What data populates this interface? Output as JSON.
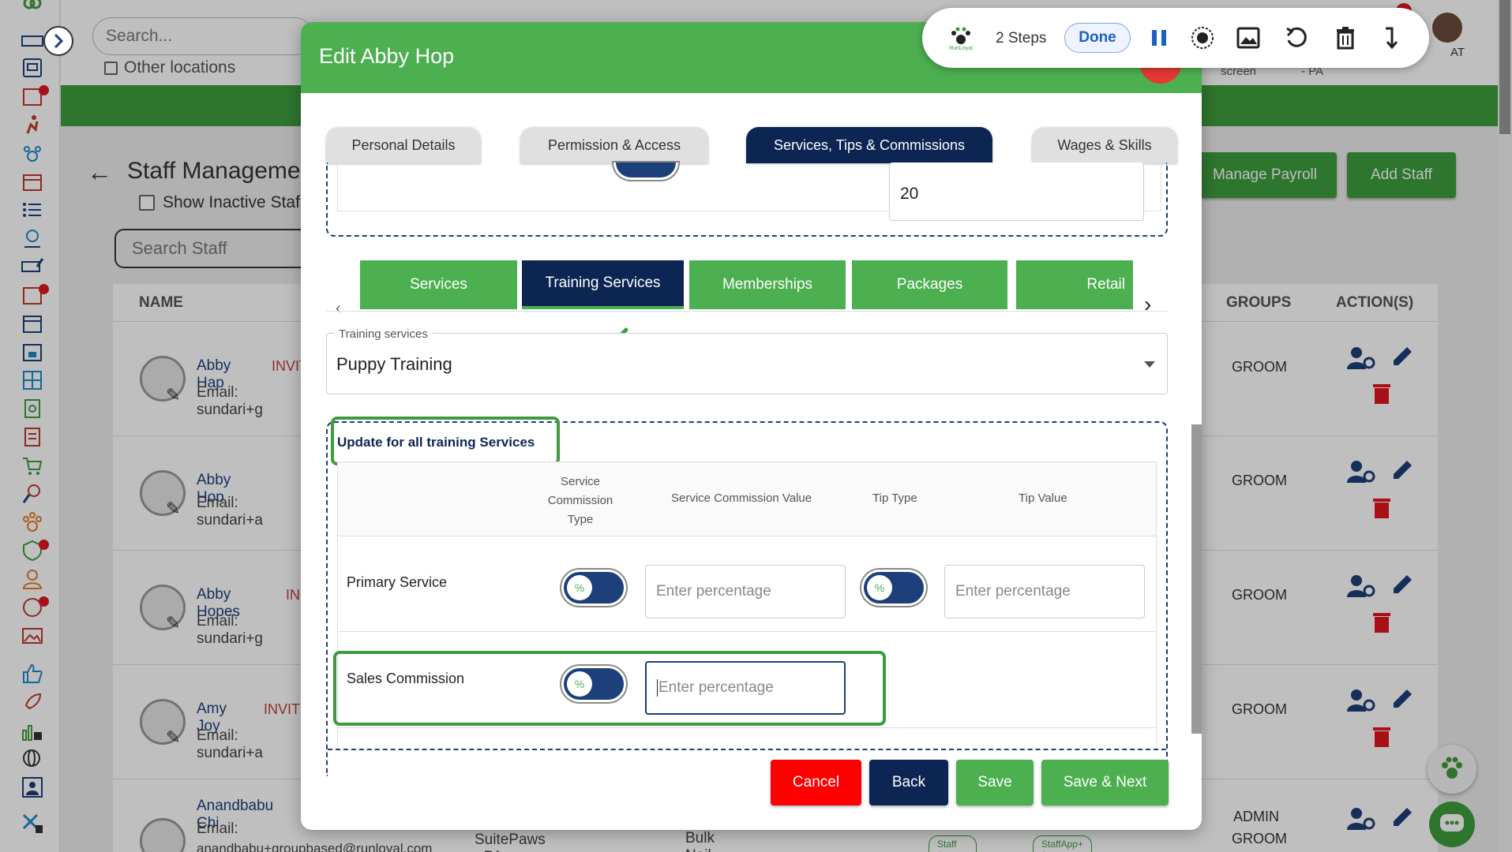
{
  "background": {
    "search_placeholder": "Search...",
    "other_locations": "Other locations",
    "page_title": "Staff Managemen",
    "show_inactive": "Show Inactive Staf",
    "search_staff": "Search Staff",
    "manage_payroll": "Manage Payroll",
    "add_staff": "Add Staff",
    "top_screen": "screen",
    "top_pa": "- PA",
    "top_at": "AT",
    "headers": {
      "name": "NAME",
      "groups": "GROUPS",
      "actions": "ACTION(S)"
    },
    "staff": [
      {
        "name": "Abby Hap",
        "status": "INVIT",
        "email": "Email: sundari+g",
        "group": "GROOM"
      },
      {
        "name": "Abby Hop",
        "status": "",
        "email": "Email: sundari+a",
        "group": "GROOM"
      },
      {
        "name": "Abby Hopes",
        "status": "IN",
        "email": "Email: sundari+g",
        "group": "GROOM"
      },
      {
        "name": "Amy Joy",
        "status": "INVIT",
        "email": "Email: sundari+a",
        "group": "GROOM"
      },
      {
        "name": "Anandbabu Chi",
        "status": "",
        "email": "Email:",
        "email2": "anandbabu+groupbased@runloyal.com",
        "group": "ADMIN",
        "group2": "GROOM"
      }
    ],
    "bottom_location": "SuitePaws - PA",
    "bottom_service": "Bulk Nail Trim",
    "badges": [
      "Staff App Access",
      "StaffApp+ for Kennel"
    ]
  },
  "modal": {
    "title": "Edit Abby Hop",
    "tabs": [
      "Personal Details",
      "Permission & Access",
      "Services, Tips & Commissions",
      "Wages & Skills"
    ],
    "top_value": "20",
    "service_tabs": [
      "Services",
      "Training Services",
      "Memberships",
      "Packages",
      "Retail"
    ],
    "training_label": "Training services",
    "training_value": "Puppy Training",
    "update_all": "Update for all training Services",
    "table_headers": {
      "sct1": "Service",
      "sct2": "Commission",
      "sct3": "Type",
      "scv": "Service Commission Value",
      "tip_type": "Tip Type",
      "tip_value": "Tip Value"
    },
    "primary_service": "Primary Service",
    "sales_commission": "Sales Commission",
    "percent_symbol": "%",
    "placeholder": "Enter percentage",
    "buttons": {
      "cancel": "Cancel",
      "back": "Back",
      "save": "Save",
      "save_next": "Save & Next"
    }
  },
  "toolbar": {
    "steps": "2 Steps",
    "done": "Done",
    "logo_text": "RunLoyal"
  },
  "colors": {
    "green": "#4caf50",
    "navy": "#0d2553",
    "red": "#e53935",
    "blue": "#1d3f7a"
  }
}
